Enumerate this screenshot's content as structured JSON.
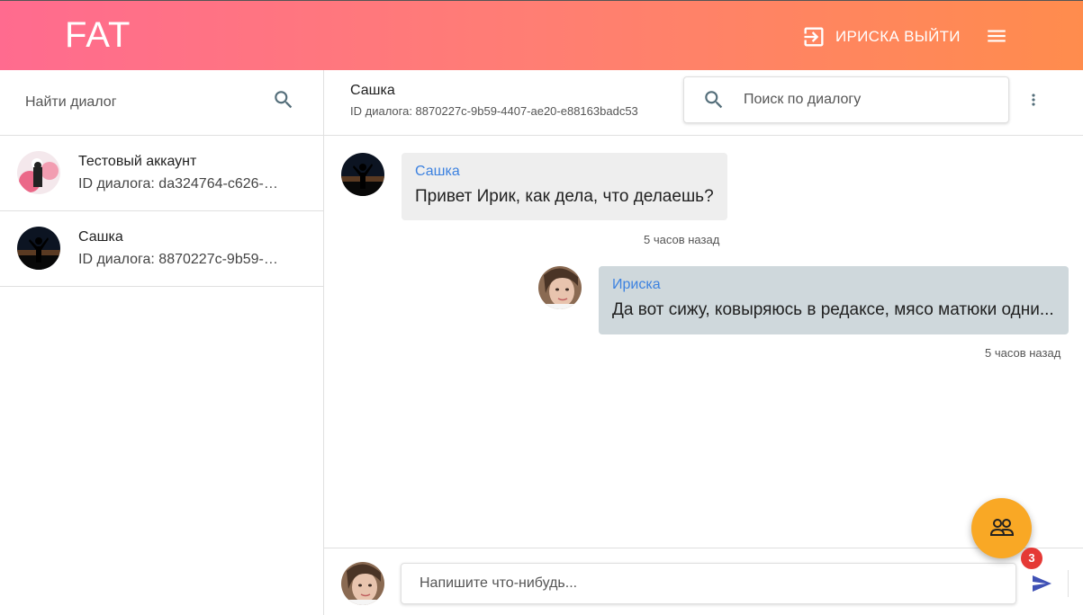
{
  "app": {
    "logo": "FAT",
    "logout_label": "ИРИСКА ВЫЙТИ"
  },
  "sidebar": {
    "search_placeholder": "Найти диалог",
    "dialogs": [
      {
        "name": "Тестовый аккаунт",
        "subtitle": "ID диалога: da324764-c626-…"
      },
      {
        "name": "Сашка",
        "subtitle": "ID диалога: 8870227c-9b59-…"
      }
    ]
  },
  "chat": {
    "title": "Сашка",
    "dialog_id": "ID диалога: 8870227c-9b59-4407-ae20-e88163badc53",
    "search_placeholder": "Поиск по диалогу",
    "messages": [
      {
        "author": "Сашка",
        "text": "Привет Ирик, как дела, что делаешь?",
        "time": "5 часов назад"
      },
      {
        "author": "Ириска",
        "text": "Да вот сижу, ковыряюсь в редаксе, мясо матюки одни...",
        "time": "5 часов назад"
      }
    ],
    "composer_placeholder": "Напишите что-нибудь..."
  },
  "fab": {
    "badge": "3"
  },
  "colors": {
    "accent": "#f9a825",
    "author": "#3d82e0",
    "header_start": "#ff6b8f",
    "header_end": "#ff8c4d"
  }
}
